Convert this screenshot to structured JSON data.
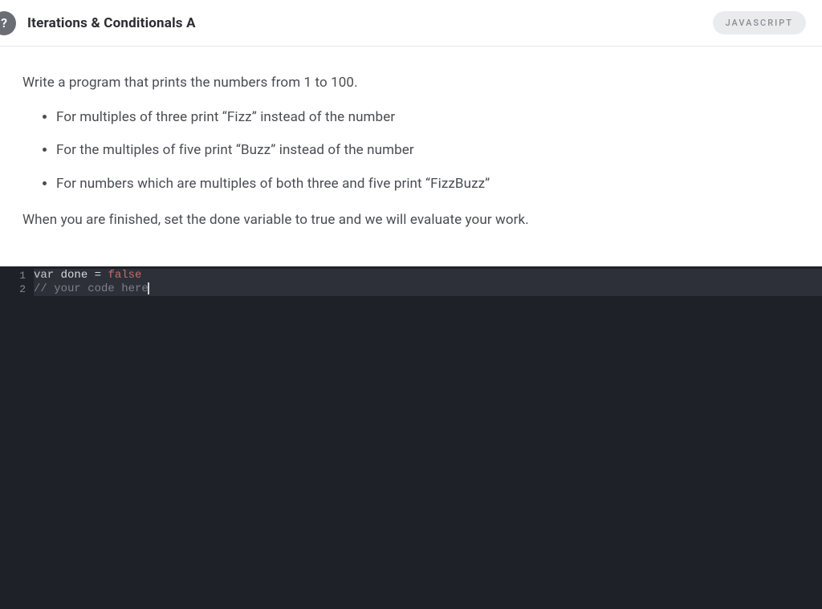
{
  "header": {
    "help_icon": "?",
    "title": "Iterations & Conditionals A",
    "language_pill": "JAVASCRIPT"
  },
  "instructions": {
    "intro": "Write a program that prints the numbers from 1 to 100.",
    "items": [
      "For multiples of three print “Fizz” instead of the number",
      "For the multiples of five print “Buzz” instead of the number",
      "For numbers which are multiples of both three and five print “FizzBuzz”"
    ],
    "outro": "When you are finished, set the done variable to true and we will evaluate your work."
  },
  "editor": {
    "gutter": [
      "1",
      "2"
    ],
    "line1": {
      "kw": "var",
      "sp1": " ",
      "ident": "done",
      "sp2": " ",
      "op": "=",
      "sp3": " ",
      "val": "false"
    },
    "line2": {
      "comment": "// your code here"
    }
  }
}
